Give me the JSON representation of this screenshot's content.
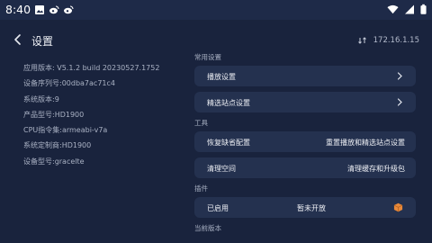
{
  "status_bar": {
    "time": "8:40",
    "left_icons": [
      "image-icon",
      "weibo-icon",
      "weibo-icon"
    ],
    "right_icons": [
      "wifi-icon",
      "signal-icon",
      "battery-icon"
    ]
  },
  "header": {
    "title": "设置",
    "ip": "172.16.1.15"
  },
  "device_info": [
    "应用版本: V5.1.2 build 20230527.1752",
    "设备序列号:00dba7ac71c4",
    "系统版本:9",
    "产品型号:HD1900",
    "CPU指令集:armeabi-v7a",
    "系统定制商:HD1900",
    "设备型号:gracelte"
  ],
  "sections": {
    "common": {
      "label": "常用设置",
      "items": [
        "播放设置",
        "精选站点设置"
      ]
    },
    "tools": {
      "label": "工具",
      "rows": [
        {
          "left": "恢复缺省配置",
          "right": "重置播放和精选站点设置"
        },
        {
          "left": "清理空间",
          "right": "清理缓存和升级包"
        }
      ]
    },
    "plugins": {
      "label": "插件",
      "row": {
        "left": "已启用",
        "middle": "暂未开放"
      }
    },
    "current_version": {
      "label": "当前版本"
    }
  },
  "colors": {
    "background": "#19233d",
    "card": "#24314f",
    "status_bar": "#1e2a48",
    "badge": "#e8893a"
  }
}
